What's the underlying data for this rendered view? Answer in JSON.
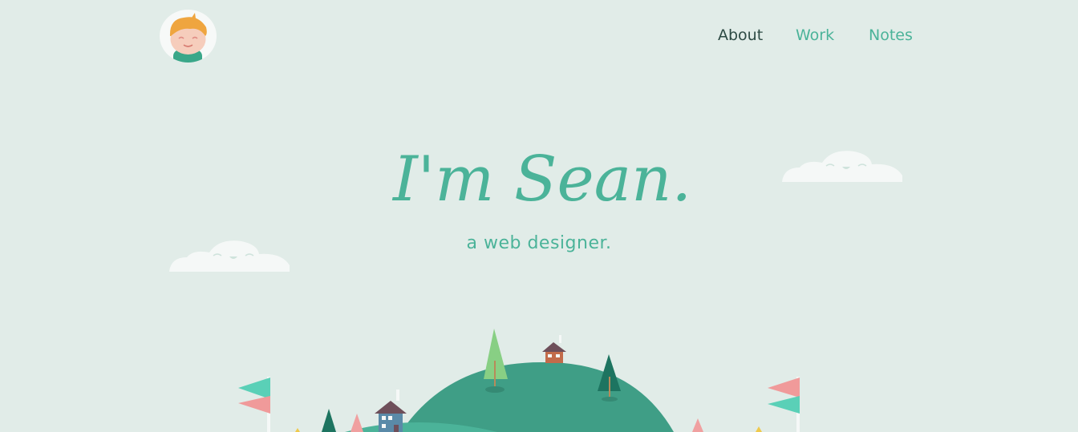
{
  "colors": {
    "background": "#e1ece8",
    "accent": "#4bb399",
    "nav_active": "#2d4a44",
    "hill": "#3f9e86",
    "cloud": "#f5f8f7"
  },
  "header": {
    "logo_icon": "boy-avatar-icon",
    "nav": [
      {
        "label": "About",
        "active": true
      },
      {
        "label": "Work",
        "active": false
      },
      {
        "label": "Notes",
        "active": false
      }
    ]
  },
  "hero": {
    "title": "I'm Sean.",
    "subtitle": "a web designer."
  }
}
